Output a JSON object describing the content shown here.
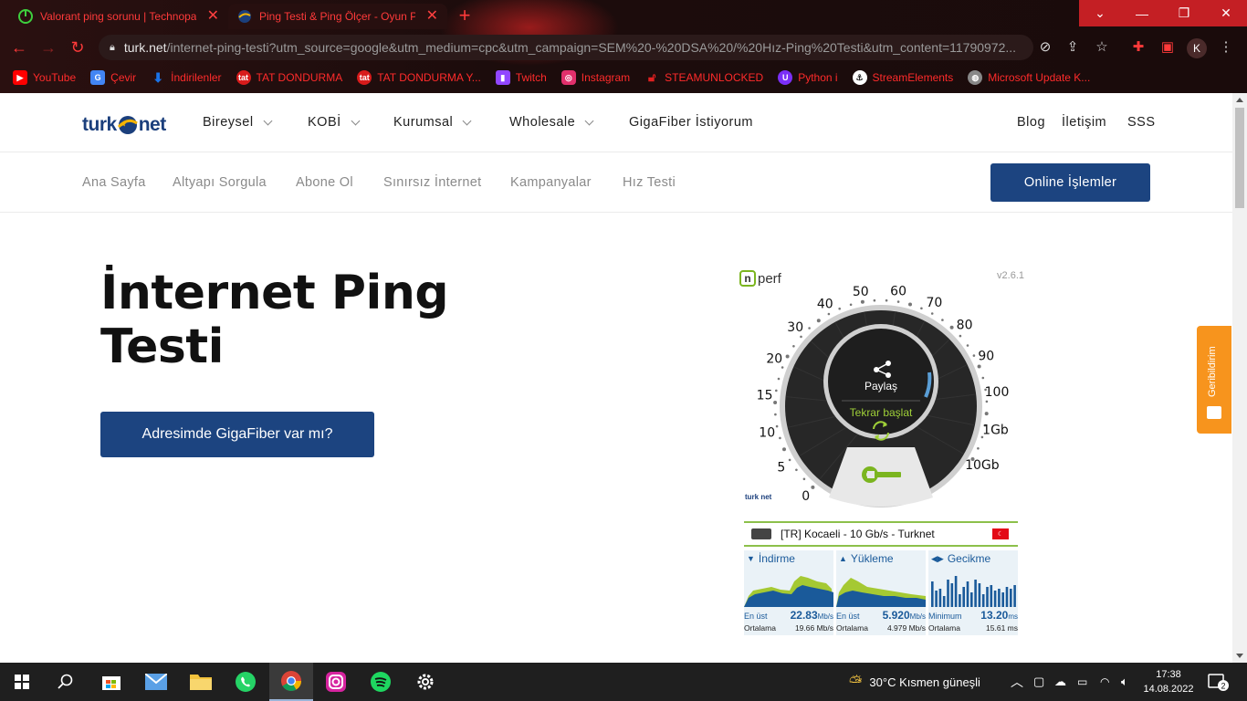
{
  "browser": {
    "tabs": [
      {
        "title": "Valorant ping sorunu | Technopat",
        "active": false
      },
      {
        "title": "Ping Testi & Ping Ölçer - Oyun Pi",
        "active": true
      }
    ],
    "url_host": "turk.net",
    "url_rest": "/internet-ping-testi?utm_source=google&utm_medium=cpc&utm_campaign=SEM%20-%20DSA%20/%20Hız-Ping%20Testi&utm_content=11790972...",
    "profile_initial": "K",
    "bookmarks": [
      {
        "label": "YouTube",
        "icon": "youtube-icon",
        "color": "#ff0000"
      },
      {
        "label": "Çevir",
        "icon": "translate-icon",
        "color": "#4285f4"
      },
      {
        "label": "İndirilenler",
        "icon": "download-icon",
        "color": "#1a73e8"
      },
      {
        "label": "TAT DONDURMA",
        "icon": "tat-icon",
        "color": "#d81b1b"
      },
      {
        "label": "TAT DONDURMA Y...",
        "icon": "tat-icon",
        "color": "#d81b1b"
      },
      {
        "label": "Twitch",
        "icon": "twitch-icon",
        "color": "#9146ff"
      },
      {
        "label": "Instagram",
        "icon": "instagram-icon",
        "color": "#e1306c"
      },
      {
        "label": "STEAMUNLOCKED",
        "icon": "steam-lock-icon",
        "color": "#e02020"
      },
      {
        "label": "Python i",
        "icon": "python-icon",
        "color": "#7b2ff7"
      },
      {
        "label": "StreamElements",
        "icon": "streamelements-icon",
        "color": "#ffffff"
      },
      {
        "label": "Microsoft Update K...",
        "icon": "globe-icon",
        "color": "#bbbbbb"
      }
    ]
  },
  "site": {
    "logo_left": "turk",
    "logo_right": "net",
    "main_nav": [
      {
        "label": "Bireysel",
        "dropdown": true
      },
      {
        "label": "KOBİ",
        "dropdown": true
      },
      {
        "label": "Kurumsal",
        "dropdown": true
      },
      {
        "label": "Wholesale",
        "dropdown": true
      },
      {
        "label": "GigaFiber İstiyorum",
        "dropdown": false
      }
    ],
    "right_nav": [
      "Blog",
      "İletişim",
      "SSS"
    ],
    "sub_nav": [
      "Ana Sayfa",
      "Altyapı Sorgula",
      "Abone Ol",
      "Sınırsız İnternet",
      "Kampanyalar",
      "Hız Testi"
    ],
    "online_button": "Online İşlemler",
    "hero_title_line1": "İnternet Ping",
    "hero_title_line2": "Testi",
    "cta_button": "Adresimde GigaFiber var mı?",
    "feedback_label": "Geribildirim",
    "brand_color": "#1c4480"
  },
  "speedtest": {
    "brand": "perf",
    "version": "v2.6.1",
    "scale_labels": [
      "0",
      "5",
      "10",
      "15",
      "20",
      "30",
      "40",
      "50",
      "60",
      "70",
      "80",
      "90",
      "100",
      "1Gb",
      "10Gb"
    ],
    "share_label": "Paylaş",
    "restart_label": "Tekrar başlat",
    "small_logo": "turk net",
    "server": "[TR] Kocaeli - 10 Gb/s - Turknet",
    "download": {
      "title": "İndirme",
      "max_label": "En üst",
      "max": "22.83",
      "max_unit": "Mb/s",
      "avg_label": "Ortalama",
      "avg": "19.66 Mb/s"
    },
    "upload": {
      "title": "Yükleme",
      "max_label": "En üst",
      "max": "5.920",
      "max_unit": "Mb/s",
      "avg_label": "Ortalama",
      "avg": "4.979 Mb/s"
    },
    "latency": {
      "title": "Gecikme",
      "min_label": "Minimum",
      "min": "13.20",
      "min_unit": "ms",
      "avg_label": "Ortalama",
      "avg": "15.61 ms"
    }
  },
  "taskbar": {
    "weather": "30°C  Kısmen güneşli",
    "time": "17:38",
    "date": "14.08.2022",
    "notifications": "2"
  }
}
